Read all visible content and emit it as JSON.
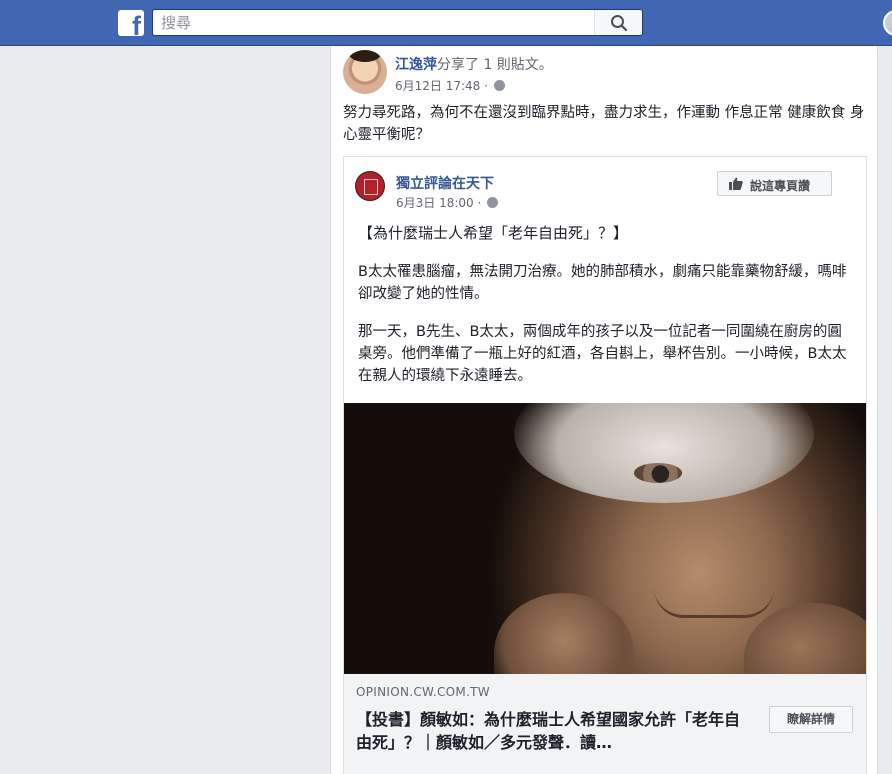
{
  "topbar": {
    "logo_letter": "f",
    "search_placeholder": "搜尋",
    "brand_color": "#4267b2",
    "icons": [
      "facebook-logo-icon",
      "search-icon"
    ]
  },
  "post": {
    "author": "江逸萍",
    "action": "分享了 1 則貼文。",
    "timestamp": "6月12日 17:48 ·",
    "privacy_icon": "globe-icon",
    "text": "努力尋死路，為何不在還沒到臨界點時，盡力求生，作運動 作息正常 健康飲食 身心靈平衡呢？"
  },
  "shared_post": {
    "page_name": "獨立評論在天下",
    "timestamp": "6月3日 18:00 ·",
    "like_page_label": "說這專頁讚",
    "title": "【為什麼瑞士人希望「老年自由死」？】",
    "paragraphs": [
      "B太太罹患腦瘤，無法開刀治療。她的肺部積水，劇痛只能靠藥物舒緩，嗎啡卻改變了她的性情。",
      "那一天，B先生、B太太，兩個成年的孩子以及一位記者一同圍繞在廚房的圓桌旁。他們準備了一瓶上好的紅酒，各自斟上，舉杯告別。一小時候，B太太在親人的環繞下永遠睡去。"
    ]
  },
  "link_preview": {
    "domain": "OPINION.CW.COM.TW",
    "title": "【投書】顏敏如：為什麼瑞士人希望國家允許「老年自由死」？｜顏敏如／多元發聲．讀…",
    "more_label": "瞭解詳情"
  }
}
